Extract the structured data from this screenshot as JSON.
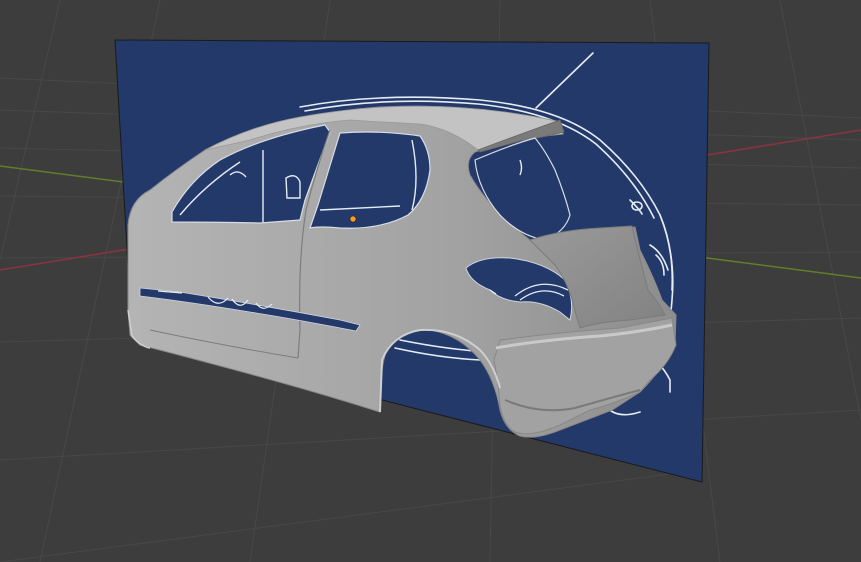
{
  "viewport": {
    "name": "3D Viewport",
    "background_color": "#3d3d3d",
    "grid_color": "#4a4a4a",
    "x_axis_color": "#a33b46",
    "y_axis_color": "#6a8f2a"
  },
  "reference_image": {
    "name": "blueprint-plane",
    "fill_color": "#23396a",
    "line_color": "#e6ecf5"
  },
  "mesh": {
    "name": "car-body-mesh",
    "base_color": "#a9a9a9",
    "highlight_color": "#c4c4c4",
    "shadow_color": "#7d7d7d"
  },
  "origin_point": {
    "color": "#ff9a1f"
  }
}
